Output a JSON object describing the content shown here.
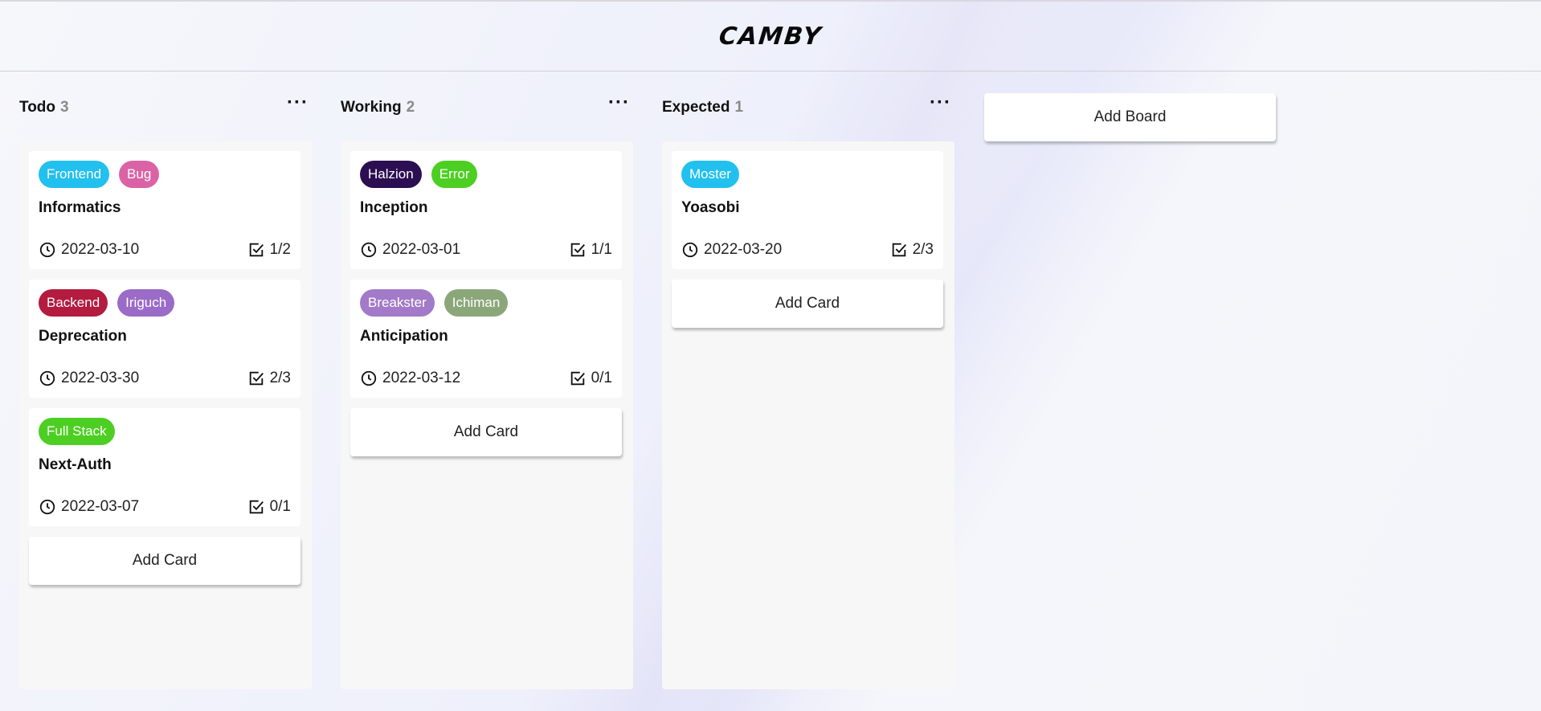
{
  "app": {
    "logo": "CAMBY"
  },
  "boards": [
    {
      "title": "Todo",
      "count": "3",
      "add_card_label": "Add Card",
      "cards": [
        {
          "labels": [
            {
              "text": "Frontend",
              "color": "#22c0ee"
            },
            {
              "text": "Bug",
              "color": "#db63a5"
            }
          ],
          "title": "Informatics",
          "date": "2022-03-10",
          "tasks": "1/2"
        },
        {
          "labels": [
            {
              "text": "Backend",
              "color": "#b31b3f"
            },
            {
              "text": "Iriguch",
              "color": "#9b6bc8"
            }
          ],
          "title": "Deprecation",
          "date": "2022-03-30",
          "tasks": "2/3"
        },
        {
          "labels": [
            {
              "text": "Full Stack",
              "color": "#4ccf22"
            }
          ],
          "title": "Next-Auth",
          "date": "2022-03-07",
          "tasks": "0/1"
        }
      ]
    },
    {
      "title": "Working",
      "count": "2",
      "add_card_label": "Add Card",
      "cards": [
        {
          "labels": [
            {
              "text": "Halzion",
              "color": "#2c0f52"
            },
            {
              "text": "Error",
              "color": "#4ccf22"
            }
          ],
          "title": "Inception",
          "date": "2022-03-01",
          "tasks": "1/1"
        },
        {
          "labels": [
            {
              "text": "Breakster",
              "color": "#a27ac8"
            },
            {
              "text": "Ichiman",
              "color": "#8ba77a"
            }
          ],
          "title": "Anticipation",
          "date": "2022-03-12",
          "tasks": "0/1"
        }
      ]
    },
    {
      "title": "Expected",
      "count": "1",
      "add_card_label": "Add Card",
      "cards": [
        {
          "labels": [
            {
              "text": "Moster",
              "color": "#22c0ee"
            }
          ],
          "title": "Yoasobi",
          "date": "2022-03-20",
          "tasks": "2/3"
        }
      ]
    }
  ],
  "add_board_label": "Add Board",
  "icons": {
    "menu": "more-dots-icon",
    "date": "clock-icon",
    "tasks": "checkbox-icon"
  }
}
